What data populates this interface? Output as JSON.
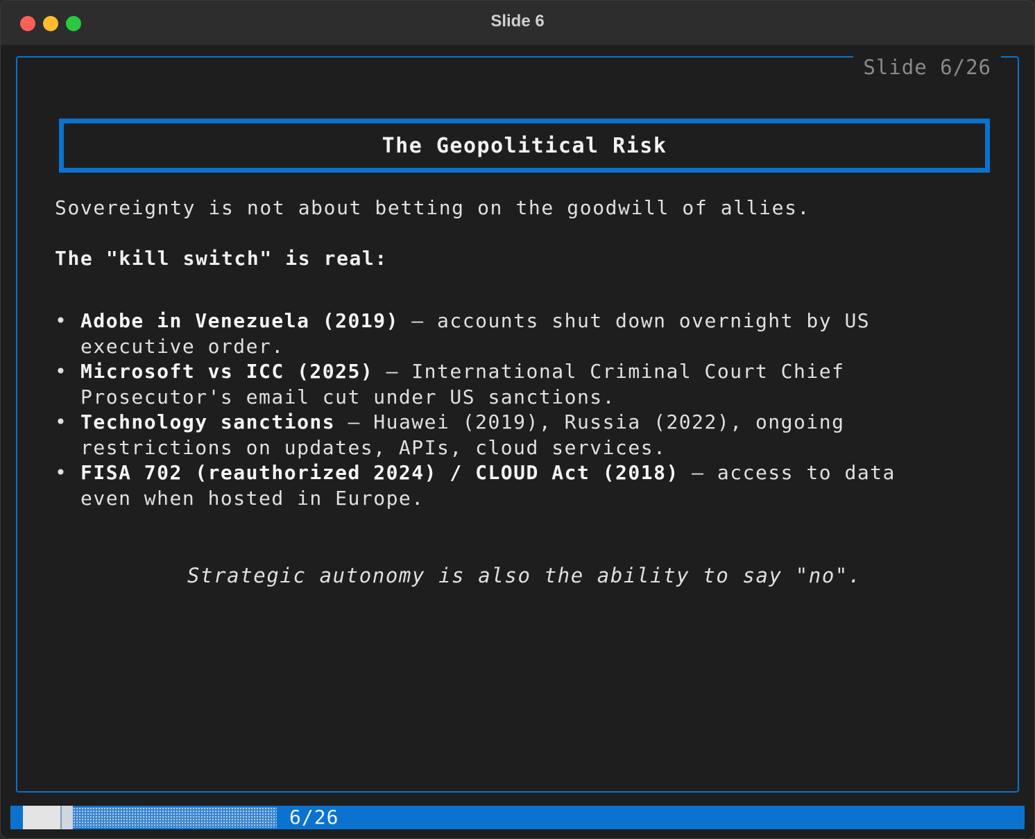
{
  "window": {
    "title": "Slide 6"
  },
  "slide": {
    "indicator": "Slide 6/26",
    "heading": "The Geopolitical Risk",
    "intro": "Sovereignty is not about betting on the goodwill of allies.",
    "subheading": "The \"kill switch\" is real:",
    "bullets": [
      {
        "bold": "Adobe in Venezuela (2019)",
        "text": " — accounts shut down overnight by US executive order."
      },
      {
        "bold": "Microsoft vs ICC (2025)",
        "text": " — International Criminal Court Chief Prosecutor's email cut under US sanctions."
      },
      {
        "bold": "Technology sanctions",
        "text": " — Huawei (2019), Russia (2022), ongoing restrictions on updates, APIs, cloud services."
      },
      {
        "bold": "FISA 702 (reauthorized 2024) / CLOUD Act (2018)",
        "text": " — access to data even when hosted in Europe."
      }
    ],
    "bullet_symbol": "•",
    "quote": "Strategic autonomy is also the ability to say \"no\"."
  },
  "statusbar": {
    "counter": "6/26",
    "current": 6,
    "total": 26
  },
  "colors": {
    "accent": "#0a73cf",
    "background": "#1e1e1e",
    "text": "#e0e0e0"
  }
}
